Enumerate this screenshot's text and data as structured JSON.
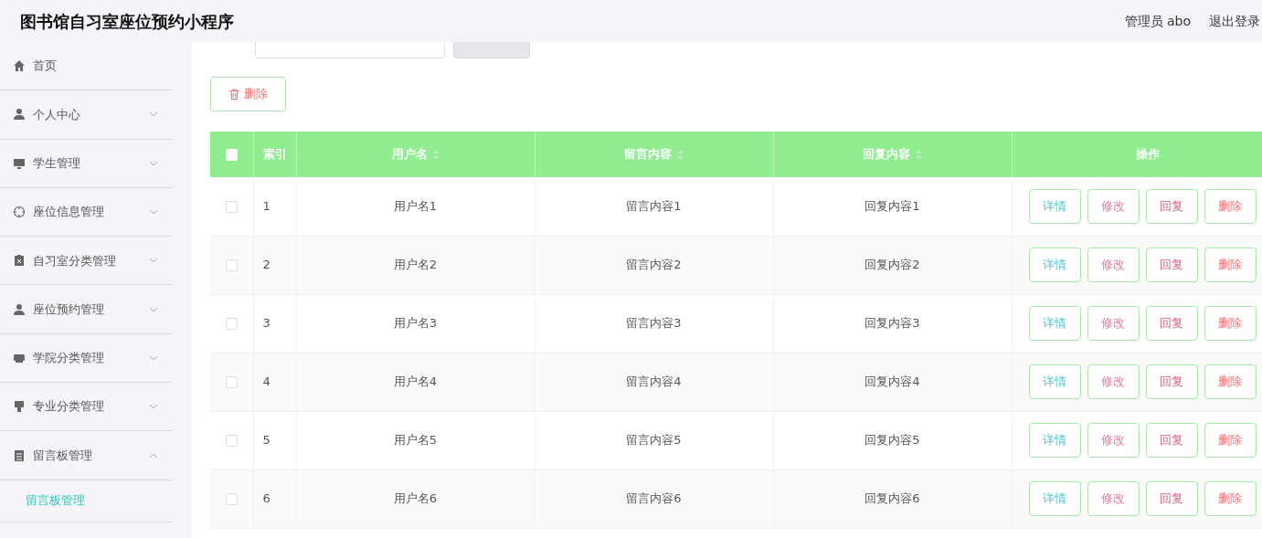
{
  "header": {
    "title": "图书馆自习室座位预约小程序",
    "user": "管理员 abo",
    "logout": "退出登录"
  },
  "sidebar": {
    "items": [
      {
        "label": "首页",
        "kind": "link"
      },
      {
        "label": "个人中心",
        "kind": "menu",
        "expanded": false
      },
      {
        "label": "学生管理",
        "kind": "menu",
        "expanded": false
      },
      {
        "label": "座位信息管理",
        "kind": "menu",
        "expanded": false
      },
      {
        "label": "自习室分类管理",
        "kind": "menu",
        "expanded": false
      },
      {
        "label": "座位预约管理",
        "kind": "menu",
        "expanded": false
      },
      {
        "label": "学院分类管理",
        "kind": "menu",
        "expanded": false
      },
      {
        "label": "专业分类管理",
        "kind": "menu",
        "expanded": false
      },
      {
        "label": "留言板管理",
        "kind": "menu",
        "expanded": true,
        "children": [
          {
            "label": "留言板管理",
            "selected": true
          }
        ]
      }
    ]
  },
  "delete_button": "删除",
  "table": {
    "select_all": {
      "checked": false
    },
    "columns": [
      {
        "label": "索引",
        "sortable": false
      },
      {
        "label": "用户名",
        "sortable": true
      },
      {
        "label": "留言内容",
        "sortable": true
      },
      {
        "label": "回复内容",
        "sortable": true
      },
      {
        "label": "操作",
        "sortable": false
      }
    ],
    "rows": [
      {
        "checked": false,
        "cells": [
          "1",
          "用户名1",
          "留言内容1",
          "回复内容1"
        ],
        "actions": [
          {
            "label": "详情",
            "kind": "view"
          },
          {
            "label": "修改",
            "kind": "edit"
          },
          {
            "label": "回复",
            "kind": "reply"
          },
          {
            "label": "删除",
            "kind": "delete"
          }
        ]
      },
      {
        "checked": false,
        "cells": [
          "2",
          "用户名2",
          "留言内容2",
          "回复内容2"
        ],
        "actions": [
          {
            "label": "详情",
            "kind": "view"
          },
          {
            "label": "修改",
            "kind": "edit"
          },
          {
            "label": "回复",
            "kind": "reply"
          },
          {
            "label": "删除",
            "kind": "delete"
          }
        ]
      },
      {
        "checked": false,
        "cells": [
          "3",
          "用户名3",
          "留言内容3",
          "回复内容3"
        ],
        "actions": [
          {
            "label": "详情",
            "kind": "view"
          },
          {
            "label": "修改",
            "kind": "edit"
          },
          {
            "label": "回复",
            "kind": "reply"
          },
          {
            "label": "删除",
            "kind": "delete"
          }
        ]
      },
      {
        "checked": false,
        "cells": [
          "4",
          "用户名4",
          "留言内容4",
          "回复内容4"
        ],
        "actions": [
          {
            "label": "详情",
            "kind": "view"
          },
          {
            "label": "修改",
            "kind": "edit"
          },
          {
            "label": "回复",
            "kind": "reply"
          },
          {
            "label": "删除",
            "kind": "delete"
          }
        ]
      },
      {
        "checked": false,
        "cells": [
          "5",
          "用户名5",
          "留言内容5",
          "回复内容5"
        ],
        "actions": [
          {
            "label": "详情",
            "kind": "view"
          },
          {
            "label": "修改",
            "kind": "edit"
          },
          {
            "label": "回复",
            "kind": "reply"
          },
          {
            "label": "删除",
            "kind": "delete"
          }
        ]
      },
      {
        "checked": false,
        "cells": [
          "6",
          "用户名6",
          "留言内容6",
          "回复内容6"
        ],
        "actions": [
          {
            "label": "详情",
            "kind": "view"
          },
          {
            "label": "修改",
            "kind": "edit"
          },
          {
            "label": "回复",
            "kind": "reply"
          },
          {
            "label": "删除",
            "kind": "delete"
          }
        ]
      }
    ]
  }
}
